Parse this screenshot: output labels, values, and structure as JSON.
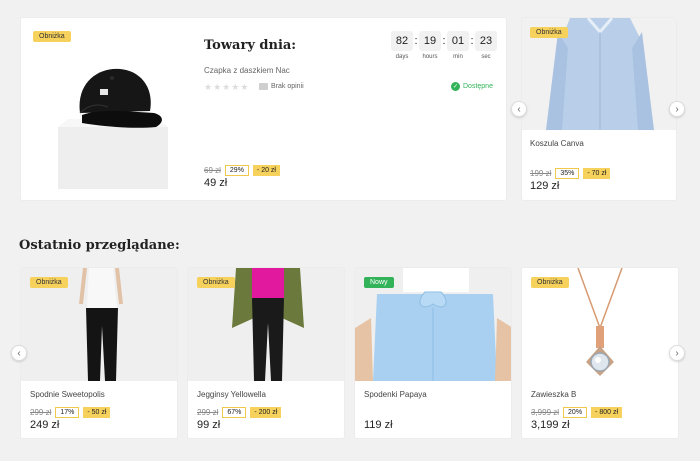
{
  "deal": {
    "badge": "Obniżka",
    "heading": "Towary dnia:",
    "product_name": "Czapka z daszkiem Nac",
    "reviews": "Brak opinii",
    "availability": "Dostępne",
    "old_price": "69 zł",
    "discount_pct": "29%",
    "discount_amount": "- 20 zł",
    "price": "49 zł",
    "rating": 0,
    "timer": [
      {
        "value": "82",
        "label": "days"
      },
      {
        "value": "19",
        "label": "hours"
      },
      {
        "value": "01",
        "label": "min"
      },
      {
        "value": "23",
        "label": "sec"
      }
    ]
  },
  "side_product": {
    "badge": "Obniżka",
    "name": "Koszula Canva",
    "old_price": "199 zł",
    "discount_pct": "35%",
    "discount_amount": "- 70 zł",
    "price": "129 zł"
  },
  "recent": {
    "title": "Ostatnio przeglądane:",
    "items": [
      {
        "badge": "Obniżka",
        "name": "Spodnie Sweetopolis",
        "old_price": "299 zł",
        "discount_pct": "17%",
        "discount_amount": "- 50 zł",
        "price": "249 zł"
      },
      {
        "badge": "Obniżka",
        "name": "Jegginsy Yellowella",
        "old_price": "299 zł",
        "discount_pct": "67%",
        "discount_amount": "- 200 zł",
        "price": "99 zł"
      },
      {
        "badge": "Nowy",
        "name": "Spodenki Papaya",
        "price": "119 zł"
      },
      {
        "badge": "Obniżka",
        "name": "Zawieszka B",
        "old_price": "3,999 zł",
        "discount_pct": "20%",
        "discount_amount": "- 800 zł",
        "price": "3,199 zł"
      }
    ]
  },
  "colors": {
    "background": "#f1f1f1",
    "badge_sale": "#f6d15c",
    "badge_new": "#32b35a",
    "available": "#32b35a"
  }
}
